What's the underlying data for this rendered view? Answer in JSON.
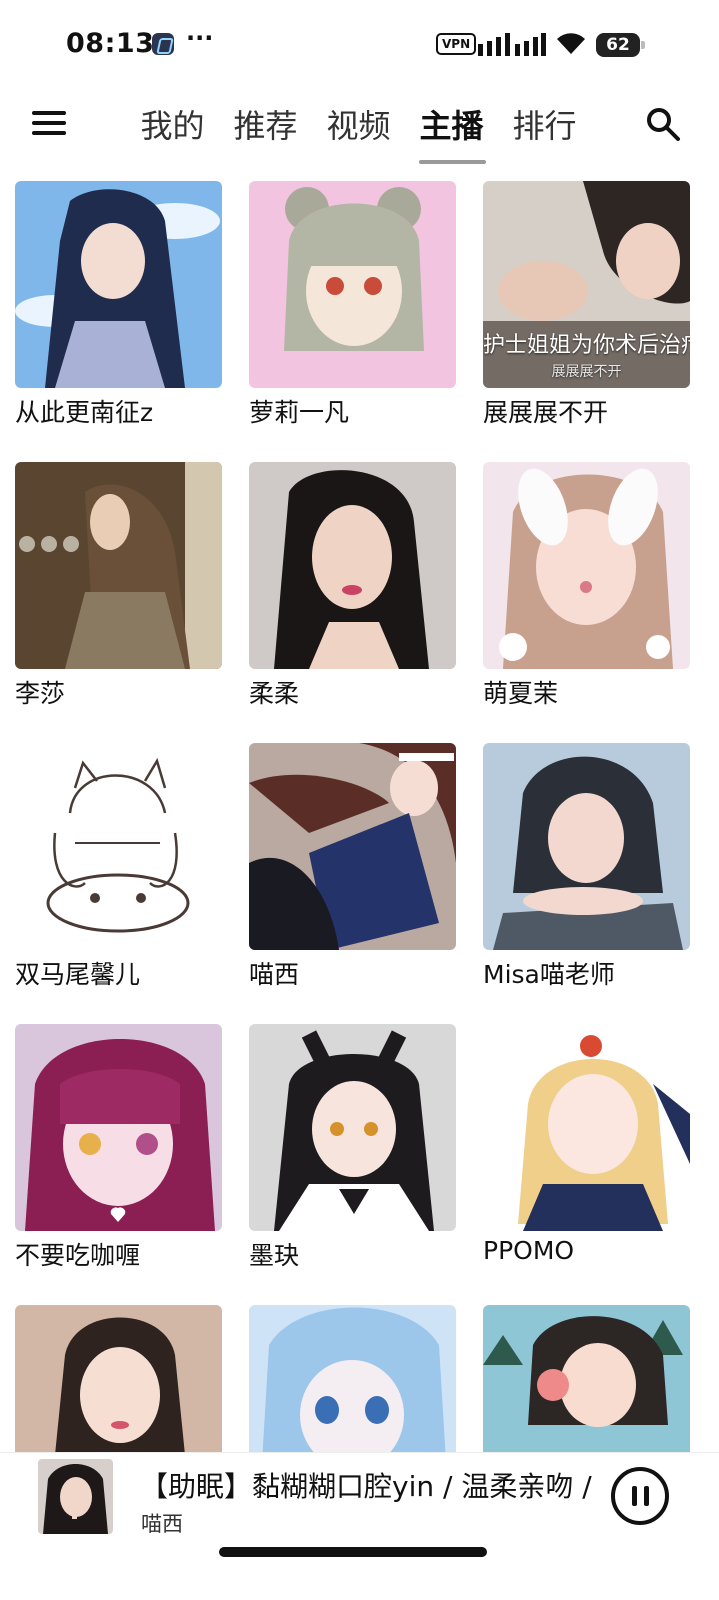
{
  "status": {
    "time": "08:13",
    "more": "···",
    "vpn": "VPN",
    "battery": "62"
  },
  "nav": {
    "tabs": [
      {
        "label": "我的",
        "active": false
      },
      {
        "label": "推荐",
        "active": false
      },
      {
        "label": "视频",
        "active": false
      },
      {
        "label": "主播",
        "active": true
      },
      {
        "label": "排行",
        "active": false
      }
    ]
  },
  "streamers": [
    {
      "name": "从此更南征z"
    },
    {
      "name": "萝莉一凡"
    },
    {
      "name": "展展展不开",
      "caption": "护士姐姐为你术后治疗",
      "caption_sub": "展展展不开"
    },
    {
      "name": "李莎"
    },
    {
      "name": "柔柔"
    },
    {
      "name": "萌夏茉"
    },
    {
      "name": "双马尾馨儿"
    },
    {
      "name": "喵西"
    },
    {
      "name": "Misa喵老师"
    },
    {
      "name": "不要吃咖喱"
    },
    {
      "name": "墨玦"
    },
    {
      "name": "PPOMO"
    },
    {
      "name": ""
    },
    {
      "name": ""
    },
    {
      "name": ""
    }
  ],
  "player": {
    "title": "【助眠】黏糊糊口腔yin / 温柔亲吻 /",
    "artist": "喵西"
  }
}
